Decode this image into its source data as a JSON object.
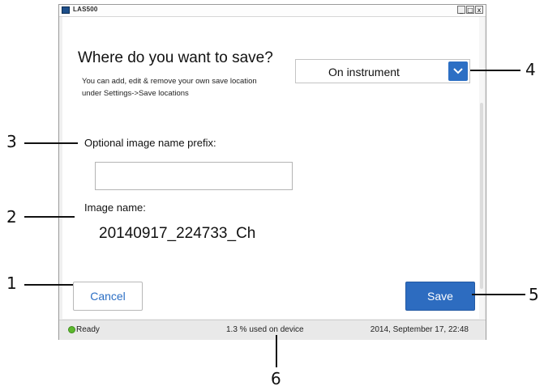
{
  "window": {
    "title": "LAS500",
    "minimize_label": "_",
    "maximize_label": "□",
    "close_label": "x"
  },
  "dialog": {
    "heading": "Where do you want to save?",
    "subtext": "You can add, edit & remove your own save location under Settings->Save locations",
    "location": {
      "selected": "On instrument"
    },
    "prefix": {
      "label": "Optional image name prefix:",
      "value": ""
    },
    "image_name": {
      "label": "Image name:",
      "value": "20140917_224733_Ch"
    },
    "cancel_label": "Cancel",
    "save_label": "Save"
  },
  "statusbar": {
    "status": "Ready",
    "usage": "1.3 % used on device",
    "datetime": "2014, September 17, 22:48"
  },
  "callouts": {
    "c1": "1",
    "c2": "2",
    "c3": "3",
    "c4": "4",
    "c5": "5",
    "c6": "6"
  },
  "colors": {
    "accent": "#2c6fc4",
    "status_ok": "#5cb82e"
  }
}
